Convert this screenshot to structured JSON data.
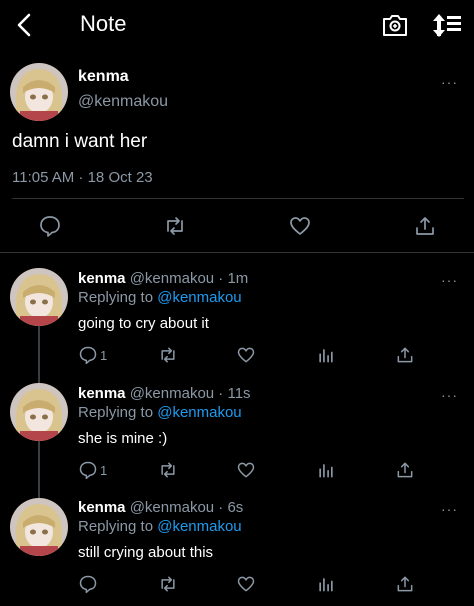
{
  "header": {
    "title": "Note",
    "back_icon": "chevron-left-icon",
    "camera_icon": "camera-icon",
    "sort_icon": "sort-arrows-icon"
  },
  "main_tweet": {
    "name": "kenma",
    "handle": "@kenmakou",
    "text": "damn i want her",
    "timestamp": "11:05 AM · 18 Oct 23",
    "more": "···"
  },
  "replies": [
    {
      "name": "kenma",
      "meta": "@kenmakou · 1m",
      "replying_label": "Replying to ",
      "mention": "@kenmakou",
      "text": "going to cry about it",
      "reply_count": "1",
      "more": "···"
    },
    {
      "name": "kenma",
      "meta": "@kenmakou · 11s",
      "replying_label": "Replying to ",
      "mention": "@kenmakou",
      "text": "she is mine :)",
      "reply_count": "1",
      "more": "···"
    },
    {
      "name": "kenma",
      "meta": "@kenmakou · 6s",
      "replying_label": "Replying to ",
      "mention": "@kenmakou",
      "text": "still crying about this",
      "reply_count": "",
      "more": "···"
    }
  ],
  "colors": {
    "background": "#000000",
    "secondary_text": "#8b98a5",
    "link": "#1d9bf0",
    "divider": "#2f3336"
  }
}
